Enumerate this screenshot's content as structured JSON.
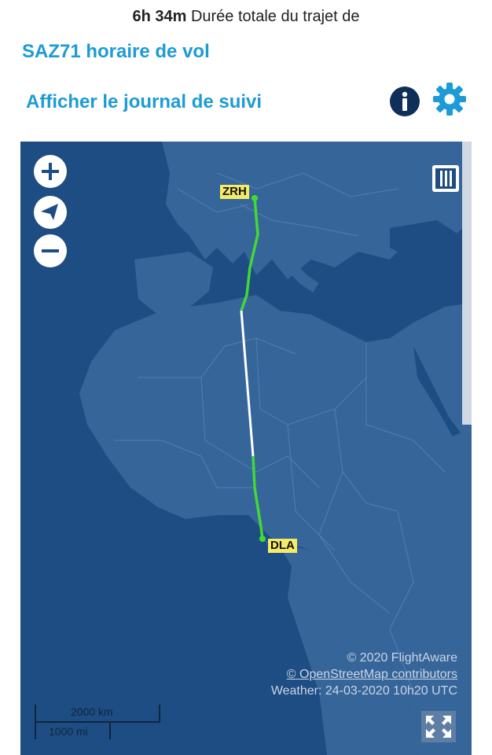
{
  "header": {
    "duration_bold": "6h 34m",
    "duration_text": "Durée totale du trajet de"
  },
  "links": {
    "flight_schedule": "SAZ71 horaire de vol",
    "track_log": "Afficher le journal de suivi"
  },
  "icons": {
    "info": "info-icon",
    "settings": "gear-icon",
    "zoom_in": "plus-icon",
    "compass": "compass-icon",
    "zoom_out": "minus-icon",
    "layers": "layers-icon",
    "fullscreen": "fullscreen-icon"
  },
  "colors": {
    "accent": "#1c9bd6",
    "icon_dark": "#0e2f57",
    "route_flown": "#42d934",
    "route_estimated": "#ffffff",
    "airport_label": "#f4ec67",
    "ocean": "#1d4d82",
    "land": "#36659a"
  },
  "map": {
    "origin": "ZRH",
    "destination": "DLA",
    "attribution_1": "© 2020 FlightAware",
    "attribution_2": "© OpenStreetMap contributors",
    "weather": "Weather: 24-03-2020 10h20 UTC",
    "scale_km": "2000 km",
    "scale_mi": "1000 mi"
  }
}
